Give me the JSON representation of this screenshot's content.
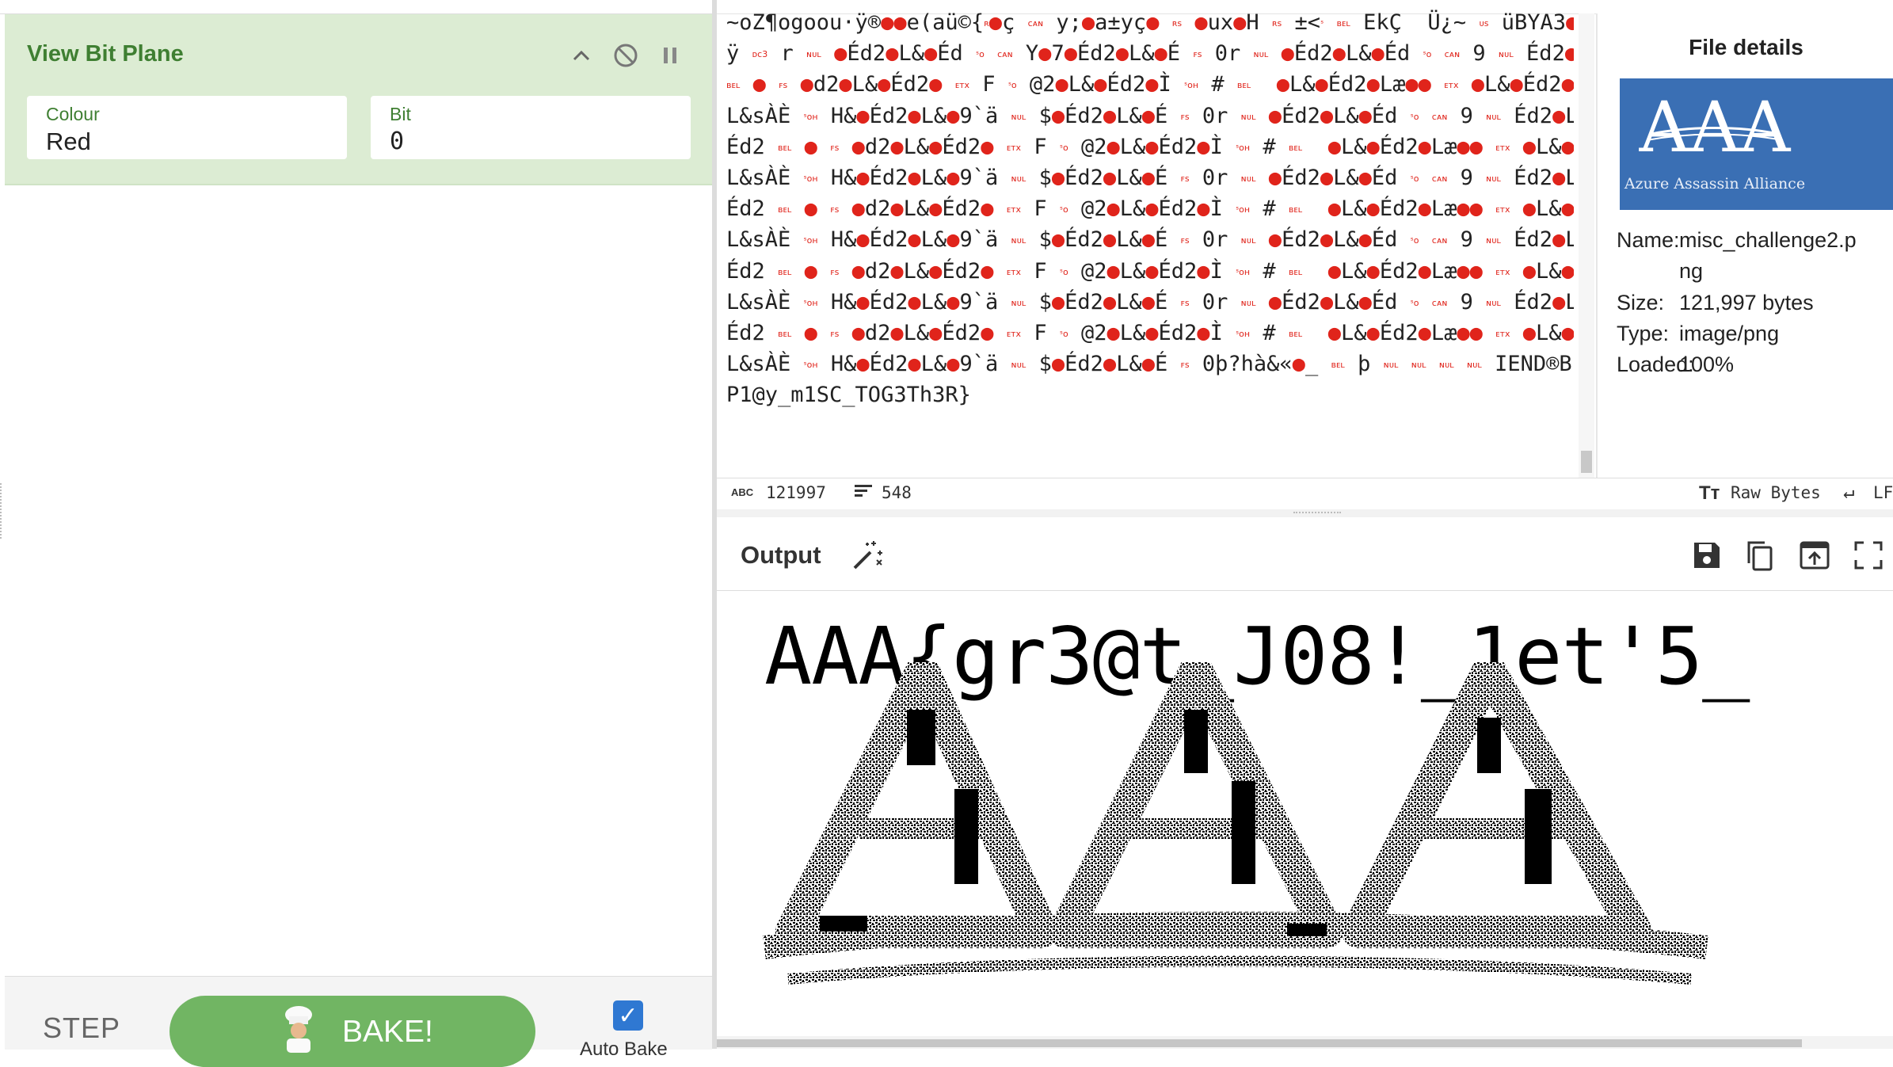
{
  "recipe": {
    "operation": {
      "title": "View Bit Plane",
      "colour_label": "Colour",
      "colour_value": "Red",
      "bit_label": "Bit",
      "bit_value": "0"
    },
    "controls": {
      "step_label": "STEP",
      "bake_label": "BAKE!",
      "auto_bake_label": "Auto Bake",
      "auto_bake_checked": true
    }
  },
  "input": {
    "lines": [
      "~oZ¶ogoou·ÿ®●●e(aü©{ʀ●ç ᴄᴀɴ y;●a±yç● ʀs ●ux●H ʀs ±<ˢ ʙᴇʟ EkÇ  Ü¿~ ᴜs üBYA3●",
      "ÿ ᴅᴄ3 r ɴᴜʟ ●Éd2●L&●Éd ˢᴏ ᴄᴀɴ Y●7●Éd2●L&●É ꜰs 0r ɴᴜʟ ●Éd2●L&●Éd ˢᴏ ᴄᴀɴ 9 ɴᴜʟ Éd2●L&●Éd2",
      "ʙᴇʟ ● ꜰs ●d2●L&●Éd2● ᴇᴛx F ˢᴏ @2●L&●Éd2●Ì ˢᴏʜ # ʙᴇʟ  ●L&●Éd2●Læ●● ᴇᴛx ●L&●Éd2●",
      "L&sÀÈ ˢᴏʜ H&●Éd2●L&●9`ä ɴᴜʟ $●Éd2●L&●É ꜰs 0r ɴᴜʟ ●Éd2●L&●Éd ˢᴏ ᴄᴀɴ 9 ɴᴜʟ Éd2●L&●",
      "Éd2 ʙᴇʟ ● ꜰs ●d2●L&●Éd2● ᴇᴛx F ˢᴏ @2●L&●Éd2●Ì ˢᴏʜ # ʙᴇʟ  ●L&●Éd2●Læ●● ᴇᴛx ●L&●Éd2●",
      "L&sÀÈ ˢᴏʜ H&●Éd2●L&●9`ä ɴᴜʟ $●Éd2●L&●É ꜰs 0r ɴᴜʟ ●Éd2●L&●Éd ˢᴏ ᴄᴀɴ 9 ɴᴜʟ Éd2●L&●",
      "Éd2 ʙᴇʟ ● ꜰs ●d2●L&●Éd2● ᴇᴛx F ˢᴏ @2●L&●Éd2●Ì ˢᴏʜ # ʙᴇʟ  ●L&●Éd2●Læ●● ᴇᴛx ●L&●Éd2●",
      "L&sÀÈ ˢᴏʜ H&●Éd2●L&●9`ä ɴᴜʟ $●Éd2●L&●É ꜰs 0r ɴᴜʟ ●Éd2●L&●Éd ˢᴏ ᴄᴀɴ 9 ɴᴜʟ Éd2●L&●",
      "Éd2 ʙᴇʟ ● ꜰs ●d2●L&●Éd2● ᴇᴛx F ˢᴏ @2●L&●Éd2●Ì ˢᴏʜ # ʙᴇʟ  ●L&●Éd2●Læ●● ᴇᴛx ●L&●Éd2●",
      "L&sÀÈ ˢᴏʜ H&●Éd2●L&●9`ä ɴᴜʟ $●Éd2●L&●É ꜰs 0r ɴᴜʟ ●Éd2●L&●Éd ˢᴏ ᴄᴀɴ 9 ɴᴜʟ Éd2●L&●",
      "Éd2 ʙᴇʟ ● ꜰs ●d2●L&●Éd2● ᴇᴛx F ˢᴏ @2●L&●Éd2●Ì ˢᴏʜ # ʙᴇʟ  ●L&●Éd2●Læ●● ᴇᴛx ●L&●Éd2●",
      "L&sÀÈ ˢᴏʜ H&●Éd2●L&●9`ä ɴᴜʟ $●Éd2●L&●É ꜰs 0þ?hà&«●_ ʙᴇʟ þ ɴᴜʟ ɴᴜʟ ɴᴜʟ ɴᴜʟ IEND®B`●",
      "P1@y_m1SC_TOG3Th3R}"
    ],
    "char_count": "121997",
    "line_count": "548",
    "encoding_label": "Raw Bytes",
    "eol_label": "LF"
  },
  "file_details": {
    "title": "File details",
    "thumbnail_text": "AAA",
    "thumbnail_subtext": "Azure Assassin Alliance",
    "name_label": "Name:",
    "name_value_1": "misc_challenge2.p",
    "name_value_2": "ng",
    "size_label": "Size:",
    "size_value": "121,997 bytes",
    "type_label": "Type:",
    "type_value": "image/png",
    "loaded_label": "Loaded:",
    "loaded_value": "100%"
  },
  "output": {
    "title": "Output",
    "flag_text": "AAA{gr3@t_J08!_1et'5_",
    "logo_text": "AAA"
  },
  "colors": {
    "recipe_green": "#3f7f32",
    "card_bg": "#dcecd3",
    "bake_green": "#71b563",
    "control_char_red": "#e0241b",
    "thumb_blue": "#3a6fb4",
    "checkbox_blue": "#2f78d2"
  },
  "icons": {
    "collapse": "chevron-up-icon",
    "disable": "disable-circle-icon",
    "pause": "pause-icon",
    "magic": "magic-wand-icon",
    "save": "save-icon",
    "copy": "copy-icon",
    "replace_input": "move-to-input-icon",
    "maximise": "maximise-icon"
  }
}
